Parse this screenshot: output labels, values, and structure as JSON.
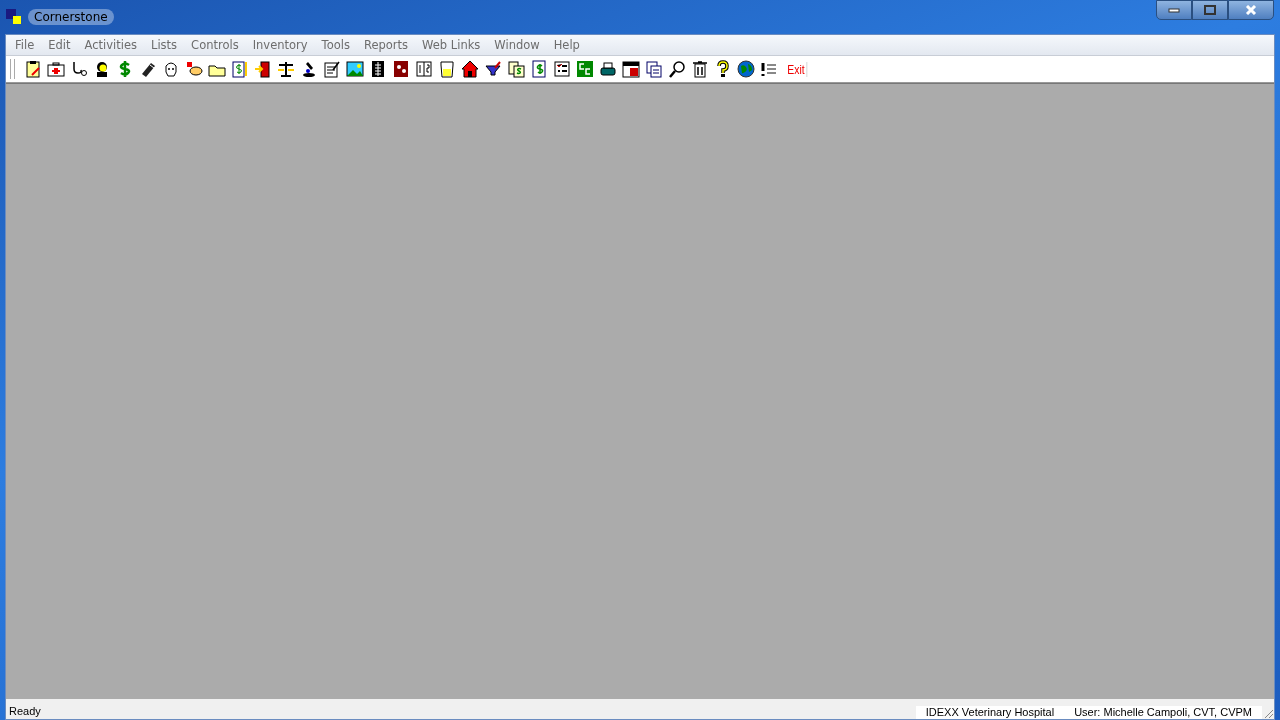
{
  "window": {
    "title": "Cornerstone"
  },
  "menu": [
    "File",
    "Edit",
    "Activities",
    "Lists",
    "Controls",
    "Inventory",
    "Tools",
    "Reports",
    "Web Links",
    "Window",
    "Help"
  ],
  "toolbar": {
    "exit_label": "Exit"
  },
  "status_bar": {
    "message": "Ready",
    "practice": "IDEXX Veterinary Hospital",
    "user": "User: Michelle Campoli, CVT, CVPM"
  }
}
